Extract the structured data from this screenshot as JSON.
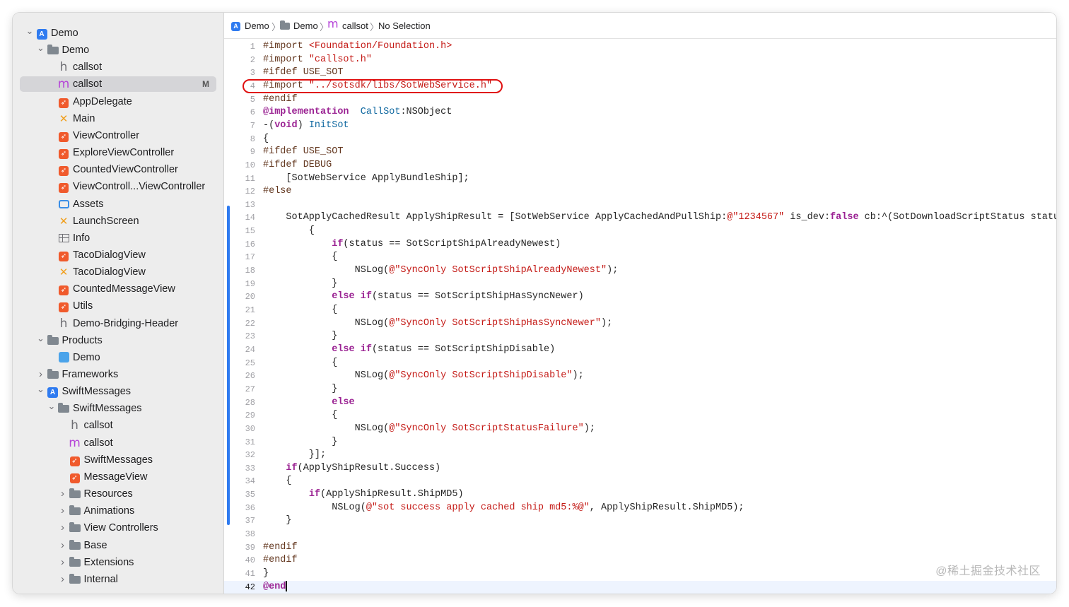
{
  "sidebar": {
    "items": [
      {
        "label": "Demo",
        "icon": "project-icon",
        "level": 0,
        "disclosure": "expanded"
      },
      {
        "label": "Demo",
        "icon": "folder-icon",
        "level": 1,
        "disclosure": "expanded"
      },
      {
        "label": "callsot",
        "icon": "header-file-icon",
        "level": 2,
        "disclosure": "none"
      },
      {
        "label": "callsot",
        "icon": "objc-file-icon",
        "level": 2,
        "disclosure": "none",
        "selected": true,
        "badge": "M"
      },
      {
        "label": "AppDelegate",
        "icon": "swift-file-icon",
        "level": 2,
        "disclosure": "none"
      },
      {
        "label": "Main",
        "icon": "storyboard-icon",
        "level": 2,
        "disclosure": "none"
      },
      {
        "label": "ViewController",
        "icon": "swift-file-icon",
        "level": 2,
        "disclosure": "none"
      },
      {
        "label": "ExploreViewController",
        "icon": "swift-file-icon",
        "level": 2,
        "disclosure": "none"
      },
      {
        "label": "CountedViewController",
        "icon": "swift-file-icon",
        "level": 2,
        "disclosure": "none"
      },
      {
        "label": "ViewControll...ViewController",
        "icon": "swift-file-icon",
        "level": 2,
        "disclosure": "none"
      },
      {
        "label": "Assets",
        "icon": "assets-icon",
        "level": 2,
        "disclosure": "none"
      },
      {
        "label": "LaunchScreen",
        "icon": "storyboard-icon",
        "level": 2,
        "disclosure": "none"
      },
      {
        "label": "Info",
        "icon": "plist-icon",
        "level": 2,
        "disclosure": "none"
      },
      {
        "label": "TacoDialogView",
        "icon": "swift-file-icon",
        "level": 2,
        "disclosure": "none"
      },
      {
        "label": "TacoDialogView",
        "icon": "storyboard-icon",
        "level": 2,
        "disclosure": "none"
      },
      {
        "label": "CountedMessageView",
        "icon": "swift-file-icon",
        "level": 2,
        "disclosure": "none"
      },
      {
        "label": "Utils",
        "icon": "swift-file-icon",
        "level": 2,
        "disclosure": "none"
      },
      {
        "label": "Demo-Bridging-Header",
        "icon": "header-file-icon",
        "level": 2,
        "disclosure": "none"
      },
      {
        "label": "Products",
        "icon": "folder-icon",
        "level": 1,
        "disclosure": "expanded"
      },
      {
        "label": "Demo",
        "icon": "app-icon",
        "level": 2,
        "disclosure": "none"
      },
      {
        "label": "Frameworks",
        "icon": "folder-icon",
        "level": 1,
        "disclosure": "collapsed"
      },
      {
        "label": "SwiftMessages",
        "icon": "project-icon",
        "level": 1,
        "disclosure": "expanded"
      },
      {
        "label": "SwiftMessages",
        "icon": "folder-icon",
        "level": 2,
        "disclosure": "expanded"
      },
      {
        "label": "callsot",
        "icon": "header-file-icon",
        "level": 3,
        "disclosure": "none"
      },
      {
        "label": "callsot",
        "icon": "objc-file-icon",
        "level": 3,
        "disclosure": "none"
      },
      {
        "label": "SwiftMessages",
        "icon": "swift-file-icon",
        "level": 3,
        "disclosure": "none"
      },
      {
        "label": "MessageView",
        "icon": "swift-file-icon",
        "level": 3,
        "disclosure": "none"
      },
      {
        "label": "Resources",
        "icon": "folder-icon",
        "level": 3,
        "disclosure": "collapsed"
      },
      {
        "label": "Animations",
        "icon": "folder-icon",
        "level": 3,
        "disclosure": "collapsed"
      },
      {
        "label": "View Controllers",
        "icon": "folder-icon",
        "level": 3,
        "disclosure": "collapsed"
      },
      {
        "label": "Base",
        "icon": "folder-icon",
        "level": 3,
        "disclosure": "collapsed"
      },
      {
        "label": "Extensions",
        "icon": "folder-icon",
        "level": 3,
        "disclosure": "collapsed"
      },
      {
        "label": "Internal",
        "icon": "folder-icon",
        "level": 3,
        "disclosure": "collapsed"
      }
    ]
  },
  "jumpbar": {
    "project": "Demo",
    "group": "Demo",
    "file_icon": "m",
    "file": "callsot",
    "symbol": "No Selection"
  },
  "editor": {
    "current_line": 42,
    "highlighted_line": 4,
    "changed_lines": [
      14,
      37
    ],
    "lines": [
      [
        [
          "dir",
          "#import "
        ],
        [
          "str",
          "<Foundation/Foundation.h>"
        ]
      ],
      [
        [
          "dir",
          "#import "
        ],
        [
          "str",
          "\"callsot.h\""
        ]
      ],
      [
        [
          "dir",
          "#ifdef USE_SOT"
        ]
      ],
      [
        [
          "dir",
          "#import "
        ],
        [
          "str",
          "\"../sotsdk/libs/SotWebService.h\""
        ]
      ],
      [
        [
          "dir",
          "#endif"
        ]
      ],
      [
        [
          "kw",
          "@implementation"
        ],
        [
          "",
          "  "
        ],
        [
          "fn",
          "CallSot"
        ],
        [
          "",
          ":NSObject"
        ]
      ],
      [
        [
          "",
          "-("
        ],
        [
          "kw",
          "void"
        ],
        [
          "",
          ") "
        ],
        [
          "fn",
          "InitSot"
        ]
      ],
      [
        [
          "",
          "{"
        ]
      ],
      [
        [
          "dir",
          "#ifdef USE_SOT"
        ]
      ],
      [
        [
          "dir",
          "#ifdef DEBUG"
        ]
      ],
      [
        [
          "",
          "    [SotWebService ApplyBundleShip];"
        ]
      ],
      [
        [
          "dir",
          "#else"
        ]
      ],
      [
        [
          "",
          ""
        ]
      ],
      [
        [
          "",
          "    SotApplyCachedResult ApplyShipResult = [SotWebService ApplyCachedAndPullShip:"
        ],
        [
          "str",
          "@\"1234567\""
        ],
        [
          "",
          " is_dev:"
        ],
        [
          "kw",
          "false"
        ],
        [
          "",
          " cb:^(SotDownloadScriptStatus status)"
        ]
      ],
      [
        [
          "",
          "        {"
        ]
      ],
      [
        [
          "",
          "            "
        ],
        [
          "kw",
          "if"
        ],
        [
          "",
          "(status == SotScriptShipAlreadyNewest)"
        ]
      ],
      [
        [
          "",
          "            {"
        ]
      ],
      [
        [
          "",
          "                NSLog("
        ],
        [
          "str",
          "@\"SyncOnly SotScriptShipAlreadyNewest\""
        ],
        [
          "",
          ");"
        ]
      ],
      [
        [
          "",
          "            }"
        ]
      ],
      [
        [
          "",
          "            "
        ],
        [
          "kw",
          "else if"
        ],
        [
          "",
          "(status == SotScriptShipHasSyncNewer)"
        ]
      ],
      [
        [
          "",
          "            {"
        ]
      ],
      [
        [
          "",
          "                NSLog("
        ],
        [
          "str",
          "@\"SyncOnly SotScriptShipHasSyncNewer\""
        ],
        [
          "",
          ");"
        ]
      ],
      [
        [
          "",
          "            }"
        ]
      ],
      [
        [
          "",
          "            "
        ],
        [
          "kw",
          "else if"
        ],
        [
          "",
          "(status == SotScriptShipDisable)"
        ]
      ],
      [
        [
          "",
          "            {"
        ]
      ],
      [
        [
          "",
          "                NSLog("
        ],
        [
          "str",
          "@\"SyncOnly SotScriptShipDisable\""
        ],
        [
          "",
          ");"
        ]
      ],
      [
        [
          "",
          "            }"
        ]
      ],
      [
        [
          "",
          "            "
        ],
        [
          "kw",
          "else"
        ]
      ],
      [
        [
          "",
          "            {"
        ]
      ],
      [
        [
          "",
          "                NSLog("
        ],
        [
          "str",
          "@\"SyncOnly SotScriptStatusFailure\""
        ],
        [
          "",
          ");"
        ]
      ],
      [
        [
          "",
          "            }"
        ]
      ],
      [
        [
          "",
          "        }];"
        ]
      ],
      [
        [
          "",
          "    "
        ],
        [
          "kw",
          "if"
        ],
        [
          "",
          "(ApplyShipResult.Success)"
        ]
      ],
      [
        [
          "",
          "    {"
        ]
      ],
      [
        [
          "",
          "        "
        ],
        [
          "kw",
          "if"
        ],
        [
          "",
          "(ApplyShipResult.ShipMD5)"
        ]
      ],
      [
        [
          "",
          "            NSLog("
        ],
        [
          "str",
          "@\"sot success apply cached ship md5:%@\""
        ],
        [
          "",
          ", ApplyShipResult.ShipMD5);"
        ]
      ],
      [
        [
          "",
          "    }"
        ]
      ],
      [
        [
          "",
          ""
        ]
      ],
      [
        [
          "dir",
          "#endif"
        ]
      ],
      [
        [
          "dir",
          "#endif"
        ]
      ],
      [
        [
          "",
          "}"
        ]
      ],
      [
        [
          "kw",
          "@end"
        ]
      ]
    ]
  },
  "watermark": "@稀土掘金技术社区"
}
